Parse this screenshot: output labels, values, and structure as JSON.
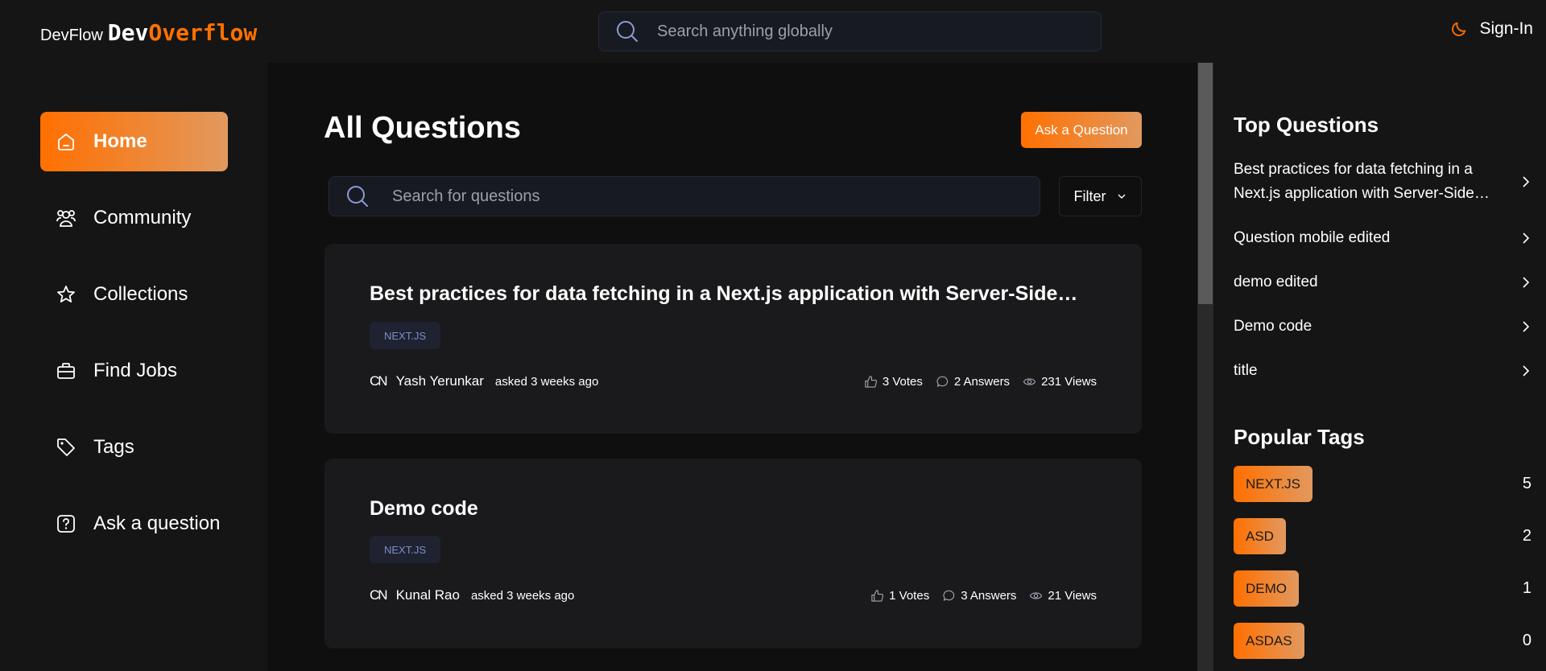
{
  "colors": {
    "accent": "#ff7000",
    "accent_light": "#e2995f",
    "bg": "#151515",
    "main_bg": "#0f0f0f",
    "card_bg": "#1a1a1c",
    "tag_text": "#7b8ec8"
  },
  "header": {
    "brand_small": "DevFlow",
    "brand_dev": "Dev",
    "brand_overflow": "Overflow",
    "search_placeholder": "Search anything globally",
    "theme_icon": "moon-icon",
    "signin_label": "Sign-In"
  },
  "sidebar": {
    "items": [
      {
        "label": "Home",
        "icon": "home-icon",
        "active": true
      },
      {
        "label": "Community",
        "icon": "users-icon",
        "active": false
      },
      {
        "label": "Collections",
        "icon": "star-icon",
        "active": false
      },
      {
        "label": "Find Jobs",
        "icon": "briefcase-icon",
        "active": false
      },
      {
        "label": "Tags",
        "icon": "tag-icon",
        "active": false
      },
      {
        "label": "Ask a question",
        "icon": "question-icon",
        "active": false
      }
    ]
  },
  "main": {
    "title": "All Questions",
    "ask_button": "Ask a Question",
    "search_placeholder": "Search for questions",
    "filter_label": "Filter",
    "questions": [
      {
        "title": "Best practices for data fetching in a Next.js application with Server-Side Rendering (SSR)",
        "tag": "NEXT.JS",
        "avatar": "CN",
        "author": "Yash Yerunkar",
        "asked": "asked 3 weeks ago",
        "votes": "3 Votes",
        "answers": "2 Answers",
        "views": "231 Views"
      },
      {
        "title": "Demo code",
        "tag": "NEXT.JS",
        "avatar": "CN",
        "author": "Kunal Rao",
        "asked": "asked 3 weeks ago",
        "votes": "1 Votes",
        "answers": "3 Answers",
        "views": "21 Views"
      }
    ]
  },
  "rightbar": {
    "top_questions_title": "Top Questions",
    "top_questions": [
      "Best practices for data fetching in a Next.js application with Server-Side Rendering (SSR)",
      "Question mobile edited",
      "demo edited",
      "Demo code",
      "title"
    ],
    "popular_tags_title": "Popular Tags",
    "popular_tags": [
      {
        "name": "NEXT.JS",
        "count": "5"
      },
      {
        "name": "ASD",
        "count": "2"
      },
      {
        "name": "DEMO",
        "count": "1"
      },
      {
        "name": "ASDAS",
        "count": "0"
      }
    ]
  }
}
